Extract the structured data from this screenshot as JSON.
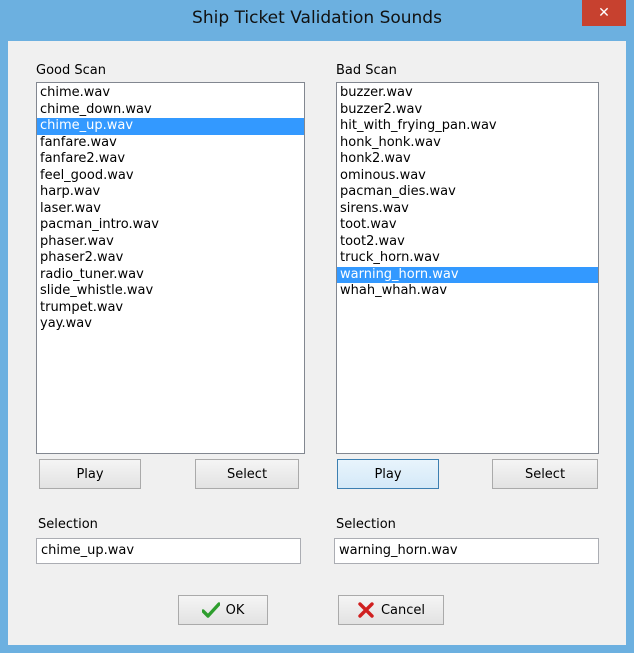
{
  "window": {
    "title": "Ship Ticket Validation Sounds",
    "close_glyph": "✕"
  },
  "good": {
    "label": "Good Scan",
    "items": [
      "chime.wav",
      "chime_down.wav",
      "chime_up.wav",
      "fanfare.wav",
      "fanfare2.wav",
      "feel_good.wav",
      "harp.wav",
      "laser.wav",
      "pacman_intro.wav",
      "phaser.wav",
      "phaser2.wav",
      "radio_tuner.wav",
      "slide_whistle.wav",
      "trumpet.wav",
      "yay.wav"
    ],
    "selected_index": 2,
    "play_label": "Play",
    "select_label": "Select",
    "selection_label": "Selection",
    "selection_value": "chime_up.wav"
  },
  "bad": {
    "label": "Bad Scan",
    "items": [
      "buzzer.wav",
      "buzzer2.wav",
      "hit_with_frying_pan.wav",
      "honk_honk.wav",
      "honk2.wav",
      "ominous.wav",
      "pacman_dies.wav",
      "sirens.wav",
      "toot.wav",
      "toot2.wav",
      "truck_horn.wav",
      "warning_horn.wav",
      "whah_whah.wav"
    ],
    "selected_index": 11,
    "play_label": "Play",
    "select_label": "Select",
    "selection_label": "Selection",
    "selection_value": "warning_horn.wav"
  },
  "footer": {
    "ok_label": "OK",
    "cancel_label": "Cancel"
  },
  "colors": {
    "titlebar": "#6cb0e0",
    "close": "#c7412f",
    "selection": "#3399ff",
    "ok_icon": "#2e9e2e",
    "cancel_icon": "#d02020"
  },
  "icons": {
    "ok": "checkmark-icon",
    "cancel": "x-icon",
    "close": "close-icon"
  }
}
